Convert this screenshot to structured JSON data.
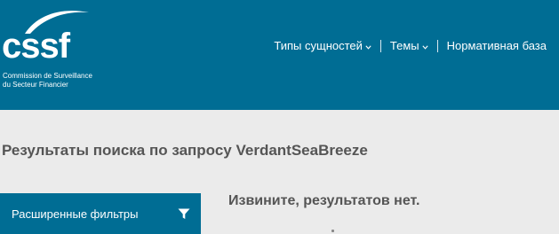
{
  "header": {
    "logo_text": "cssf",
    "logo_sub_line1": "Commission de Surveillance",
    "logo_sub_line2": "du Secteur Financier",
    "nav": [
      {
        "label": "Типы сущностей",
        "has_dropdown": true
      },
      {
        "label": "Темы",
        "has_dropdown": true
      },
      {
        "label": "Нормативная база",
        "has_dropdown": false
      }
    ]
  },
  "main": {
    "title": "Результаты поиска по запросу VerdantSeaBreeze",
    "filters_label": "Расширенные фильтры",
    "no_results": "Извините, результатов нет."
  },
  "colors": {
    "brand": "#006d94",
    "background": "#ebebeb",
    "text": "#555555"
  },
  "icons": {
    "dropdown": "chevron-down-icon",
    "filter": "filter-funnel-icon"
  }
}
